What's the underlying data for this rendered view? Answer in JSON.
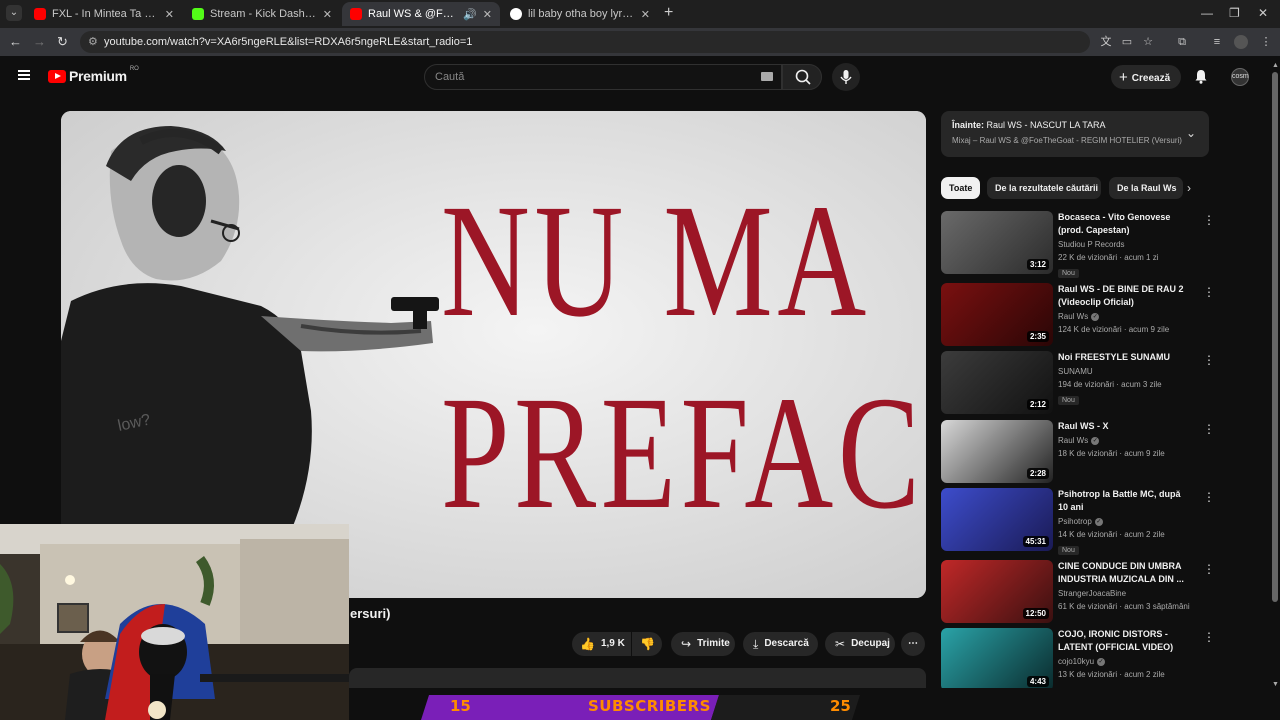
{
  "browser": {
    "tabs": [
      {
        "title": "FXL - In Mintea Ta (Official Visu",
        "icon": "youtube-icon",
        "color": "#ff0000"
      },
      {
        "title": "Stream - Kick Dashboard",
        "icon": "kick-icon",
        "color": "#53fc18"
      },
      {
        "title": "Raul WS & @FoeTheGoat -",
        "icon": "youtube-icon",
        "color": "#ff0000"
      },
      {
        "title": "lil baby otha boy lyrics - Căutare",
        "icon": "google-icon",
        "color": "#4285f4"
      }
    ],
    "url": "youtube.com/watch?v=XA6r5ngeRLE&list=RDXA6r5ngeRLE&start_radio=1"
  },
  "youtube": {
    "logo_text": "Premium",
    "logo_region": "RO",
    "search_placeholder": "Caută",
    "create_label": "Creează",
    "avatar_text": "cosm"
  },
  "video": {
    "overlay_line1": "NU MA",
    "overlay_line2": "PREFAC",
    "title_fragment": "ersuri)",
    "accent": "#9c1626"
  },
  "actions": {
    "likes": "1,9 K",
    "share": "Trimite",
    "download": "Descarcă",
    "clip": "Decupaj",
    "more": "⋯"
  },
  "sidebar": {
    "next_label": "Înainte:",
    "next_title": "Raul WS - NASCUT LA TARA",
    "next_sub": "Mixaj – Raul WS & @FoeTheGoat - REGIM HOTELIER (Versuri)",
    "chips": [
      "Toate",
      "De la rezultatele căutării",
      "De la Raul Ws"
    ],
    "recommendations": [
      {
        "title": "Bocaseca - Vito Genovese (prod. Capestan)",
        "channel": "Studiou P Records",
        "verified": false,
        "stats": "22 K de vizionări · acum 1 zi",
        "badge": "Nou",
        "duration": "3:12"
      },
      {
        "title": "Raul WS - DE BINE DE RAU 2 (Videoclip Oficial)",
        "channel": "Raul Ws",
        "verified": true,
        "stats": "124 K de vizionări · acum 9 zile",
        "badge": "",
        "duration": "2:35"
      },
      {
        "title": "Noi FREESTYLE    SUNAMU",
        "channel": "SUNAMU",
        "verified": false,
        "stats": "194 de vizionări · acum 3 zile",
        "badge": "Nou",
        "duration": "2:12"
      },
      {
        "title": "Raul WS - X",
        "channel": "Raul Ws",
        "verified": true,
        "stats": "18 K de vizionări · acum 9 zile",
        "badge": "",
        "duration": "2:28"
      },
      {
        "title": "Psihotrop la Battle MC, după 10 ani",
        "channel": "Psihotrop",
        "verified": true,
        "stats": "14 K de vizionări · acum 2 zile",
        "badge": "Nou",
        "duration": "45:31"
      },
      {
        "title": "CINE CONDUCE DIN UMBRA INDUSTRIA MUZICALA DIN ...",
        "channel": "StrangerJoacaBine",
        "verified": false,
        "stats": "61 K de vizionări · acum 3 săptămâni",
        "badge": "",
        "duration": "12:50"
      },
      {
        "title": "COJO, IRONIC DISTORS - LATENT (OFFICIAL VIDEO)",
        "channel": "cojo10kyu",
        "verified": true,
        "stats": "13 K de vizionări · acum 2 zile",
        "badge": "",
        "duration": "4:43"
      }
    ]
  },
  "overlay": {
    "current": "15",
    "label": "SUBSCRIBERS",
    "goal": "25",
    "bar_color": "#7a1fb8",
    "text_color": "#ff8c00",
    "progress": 0.45
  }
}
